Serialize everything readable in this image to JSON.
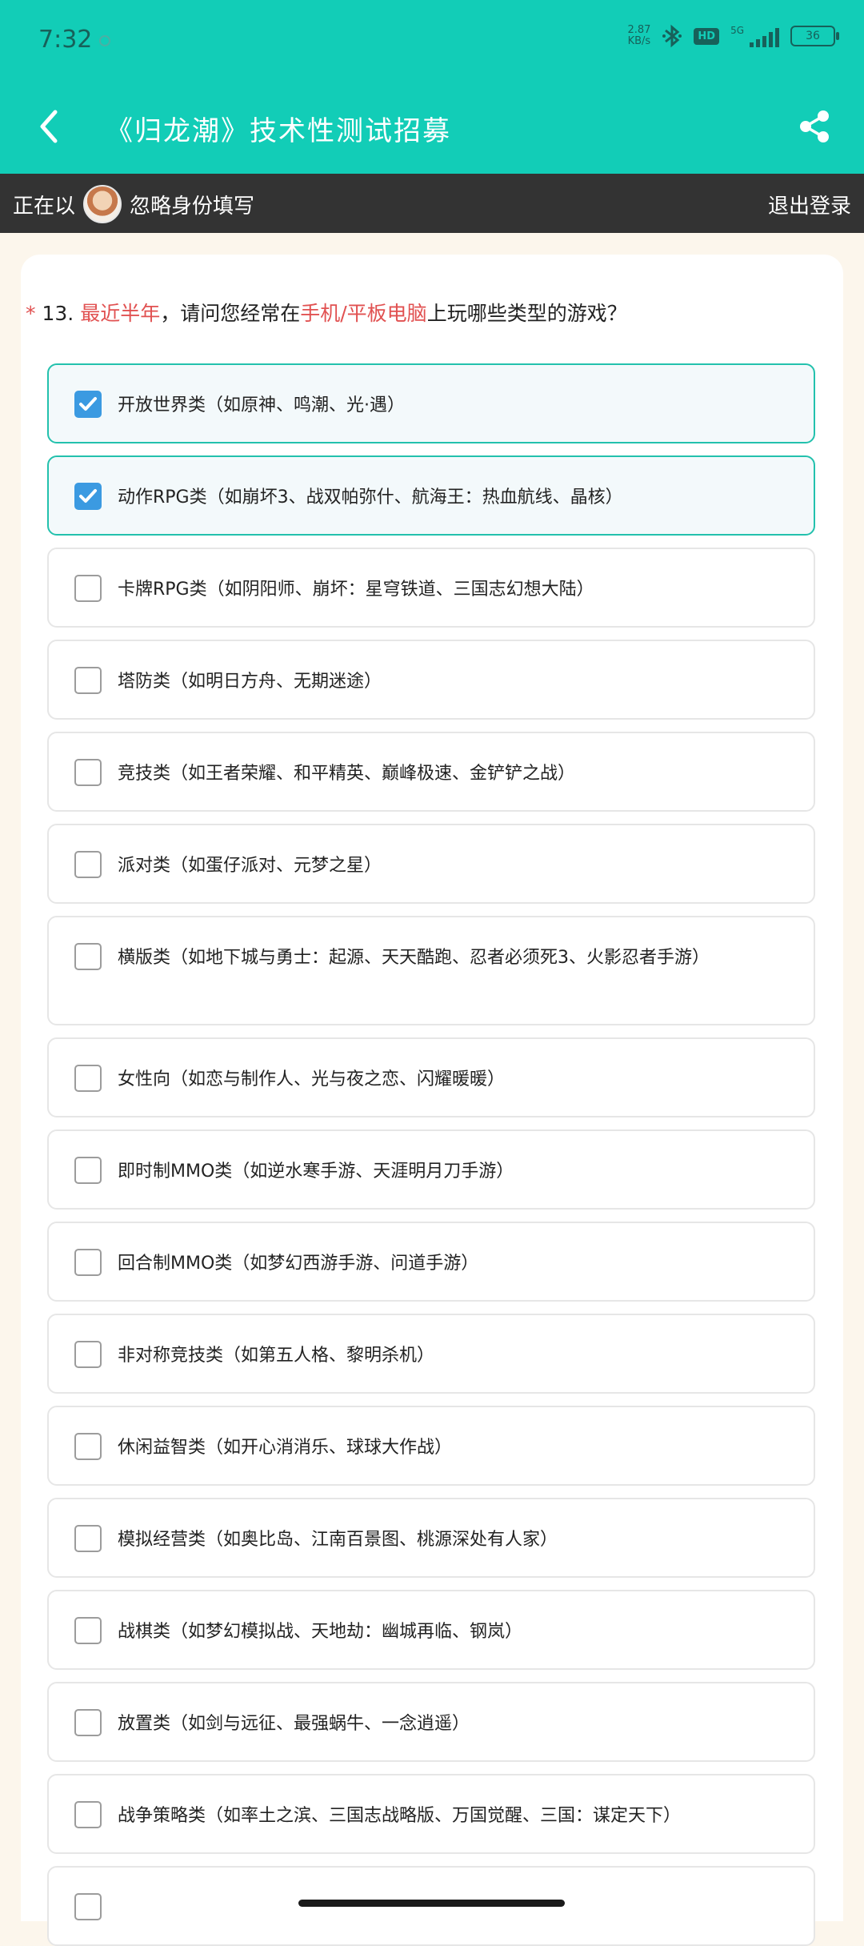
{
  "status": {
    "time": "7:32",
    "net_speed_value": "2.87",
    "net_speed_unit": "KB/s",
    "hd": "HD",
    "net_type": "5G",
    "battery": "36"
  },
  "header": {
    "title": "《归龙潮》技术性测试招募",
    "back_icon": "chevron-left-icon",
    "share_icon": "share-icon"
  },
  "user_bar": {
    "label": "正在以",
    "hint": "忽略身份填写",
    "logout": "退出登录"
  },
  "question": {
    "required_mark": "*",
    "number": "13.",
    "part1": "最近半年",
    "part2": "，请问您经常在",
    "part3": "手机/平板电脑",
    "part4": "上玩哪些类型的游戏？"
  },
  "options": [
    {
      "label": "开放世界类（如原神、鸣潮、光·遇）",
      "checked": true
    },
    {
      "label": "动作RPG类（如崩坏3、战双帕弥什、航海王：热血航线、晶核）",
      "checked": true
    },
    {
      "label": "卡牌RPG类（如阴阳师、崩坏：星穹铁道、三国志幻想大陆）",
      "checked": false
    },
    {
      "label": "塔防类（如明日方舟、无期迷途）",
      "checked": false
    },
    {
      "label": "竞技类（如王者荣耀、和平精英、巅峰极速、金铲铲之战）",
      "checked": false
    },
    {
      "label": "派对类（如蛋仔派对、元梦之星）",
      "checked": false
    },
    {
      "label": "横版类（如地下城与勇士：起源、天天酷跑、忍者必须死3、火影忍者手游）",
      "checked": false
    },
    {
      "label": "女性向（如恋与制作人、光与夜之恋、闪耀暖暖）",
      "checked": false
    },
    {
      "label": "即时制MMO类（如逆水寒手游、天涯明月刀手游）",
      "checked": false
    },
    {
      "label": "回合制MMO类（如梦幻西游手游、问道手游）",
      "checked": false
    },
    {
      "label": "非对称竞技类（如第五人格、黎明杀机）",
      "checked": false
    },
    {
      "label": "休闲益智类（如开心消消乐、球球大作战）",
      "checked": false
    },
    {
      "label": "模拟经营类（如奥比岛、江南百景图、桃源深处有人家）",
      "checked": false
    },
    {
      "label": "战棋类（如梦幻模拟战、天地劫：幽城再临、钢岚）",
      "checked": false
    },
    {
      "label": "放置类（如剑与远征、最强蜗牛、一念逍遥）",
      "checked": false
    },
    {
      "label": "战争策略类（如率土之滨、三国志战略版、万国觉醒、三国：谋定天下）",
      "checked": false
    },
    {
      "label": "",
      "checked": false
    }
  ]
}
